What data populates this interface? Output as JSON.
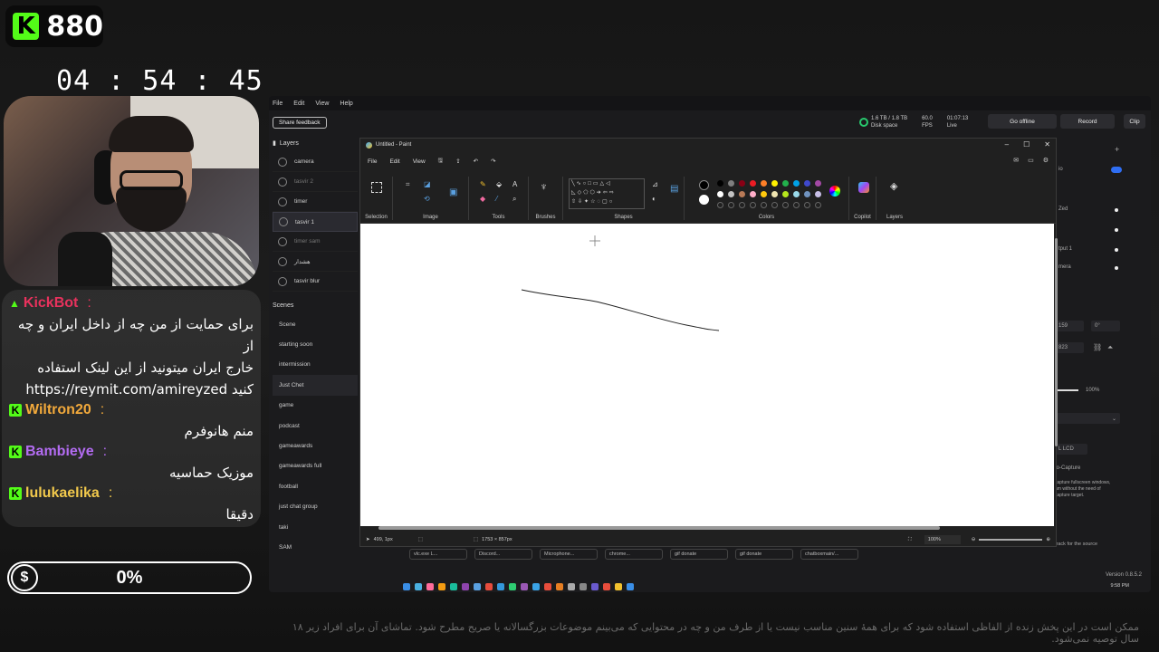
{
  "overlay": {
    "viewer_count": "880",
    "timer": "04 : 54 : 45",
    "goal_percent": "0%",
    "disclaimer": "ممکن است در این پخش زنده از الفاظی استفاده شود که برای همهٔ سنین مناسب نیست یا از طرف من و چه در محتوایی که می‌بینم موضوعات بزرگسالانه یا صریح مطرح شود. تماشای آن برای افراد زیر ۱۸ سال توصیه نمی‌شود."
  },
  "chat": [
    {
      "user": "KickBot",
      "color": "#e8325d",
      "badge": "bot",
      "sep": ":",
      "lines": [
        "برای حمایت از من چه از داخل ایران و چه از",
        "خارج ایران میتونید از این لینک استفاده",
        "کنید https://reymit.com/amireyzed"
      ]
    },
    {
      "user": "Wiltron20",
      "color": "#f2a93b",
      "badge": "kick",
      "sep": ":",
      "lines": [
        "منم هانوفرم"
      ]
    },
    {
      "user": "Bambieye",
      "color": "#b36cf2",
      "badge": "kick",
      "sep": ":",
      "lines": [
        "موزیک حماسیه"
      ]
    },
    {
      "user": "lulukaelika",
      "color": "#f2c94c",
      "badge": "kick",
      "sep": ":",
      "lines": [
        "دقیقا"
      ]
    }
  ],
  "app": {
    "menu": [
      "File",
      "Edit",
      "View",
      "Help"
    ],
    "share_feedback": "Share feedback",
    "disk": "1.6 TB / 1.8 TB",
    "disk_label": "Disk space",
    "fps": "60.0",
    "fps_label": "FPS",
    "live_time": "01:07:13",
    "live_label": "Live",
    "go_offline": "Go offline",
    "record": "Record",
    "clip": "Clip",
    "layers_title": "Layers",
    "layers": [
      {
        "name": "camera",
        "dim": false,
        "selected": false
      },
      {
        "name": "tasvir 2",
        "dim": true,
        "selected": false
      },
      {
        "name": "timer",
        "dim": false,
        "selected": false
      },
      {
        "name": "tasvir 1",
        "dim": false,
        "selected": true
      },
      {
        "name": "timer sam",
        "dim": true,
        "selected": false
      },
      {
        "name": "هشدار",
        "dim": false,
        "selected": false
      },
      {
        "name": "tasvir blur",
        "dim": false,
        "selected": false
      }
    ],
    "scenes_title": "Scenes",
    "scenes": [
      "Scene",
      "starting soon",
      "intermission",
      "Just Chet",
      "game",
      "podcast",
      "gameawards",
      "gameawards full",
      "football",
      "just chat group",
      "taki",
      "SAM"
    ],
    "active_scene": "Just Chet",
    "right_panel": {
      "io": "io",
      "red": "Zed",
      "output": "tput 1",
      "mera": "mera",
      "x_val": "159",
      "rot_val": "0°",
      "y_val": "823",
      "opacity": "100%",
      "dropdown": "L LCD",
      "capture": "to-Capture",
      "capture_desc": "capture fullscreen windows, am without the need of capture target.",
      "track": "track for the source",
      "version": "Version 0.8.5.2"
    },
    "source_tabs": [
      "vlc.exe L...",
      "Discord...",
      "Microphone...",
      "chrome...",
      "gif donate",
      "gif donate",
      "chatboxmain/..."
    ],
    "clock": "9:58 PM"
  },
  "paint": {
    "title": "Untitled - Paint",
    "menu": [
      "File",
      "Edit",
      "View"
    ],
    "groups": [
      "Selection",
      "Image",
      "Tools",
      "Brushes",
      "Shapes",
      "Colors",
      "Copilot",
      "Layers"
    ],
    "cursor_pos": "499, 1px",
    "canvas_size": "1753 × 857px",
    "zoom": "100%"
  },
  "colors": {
    "palette": [
      "#000000",
      "#7f7f7f",
      "#880015",
      "#ed1c24",
      "#ff7f27",
      "#fff200",
      "#22b14c",
      "#00a2e8",
      "#3f48cc",
      "#a349a4",
      "#ffffff",
      "#c3c3c3",
      "#b97a57",
      "#ffaec9",
      "#ffc90e",
      "#efe4b0",
      "#b5e61d",
      "#99d9ea",
      "#7092be",
      "#c8bfe7"
    ]
  }
}
